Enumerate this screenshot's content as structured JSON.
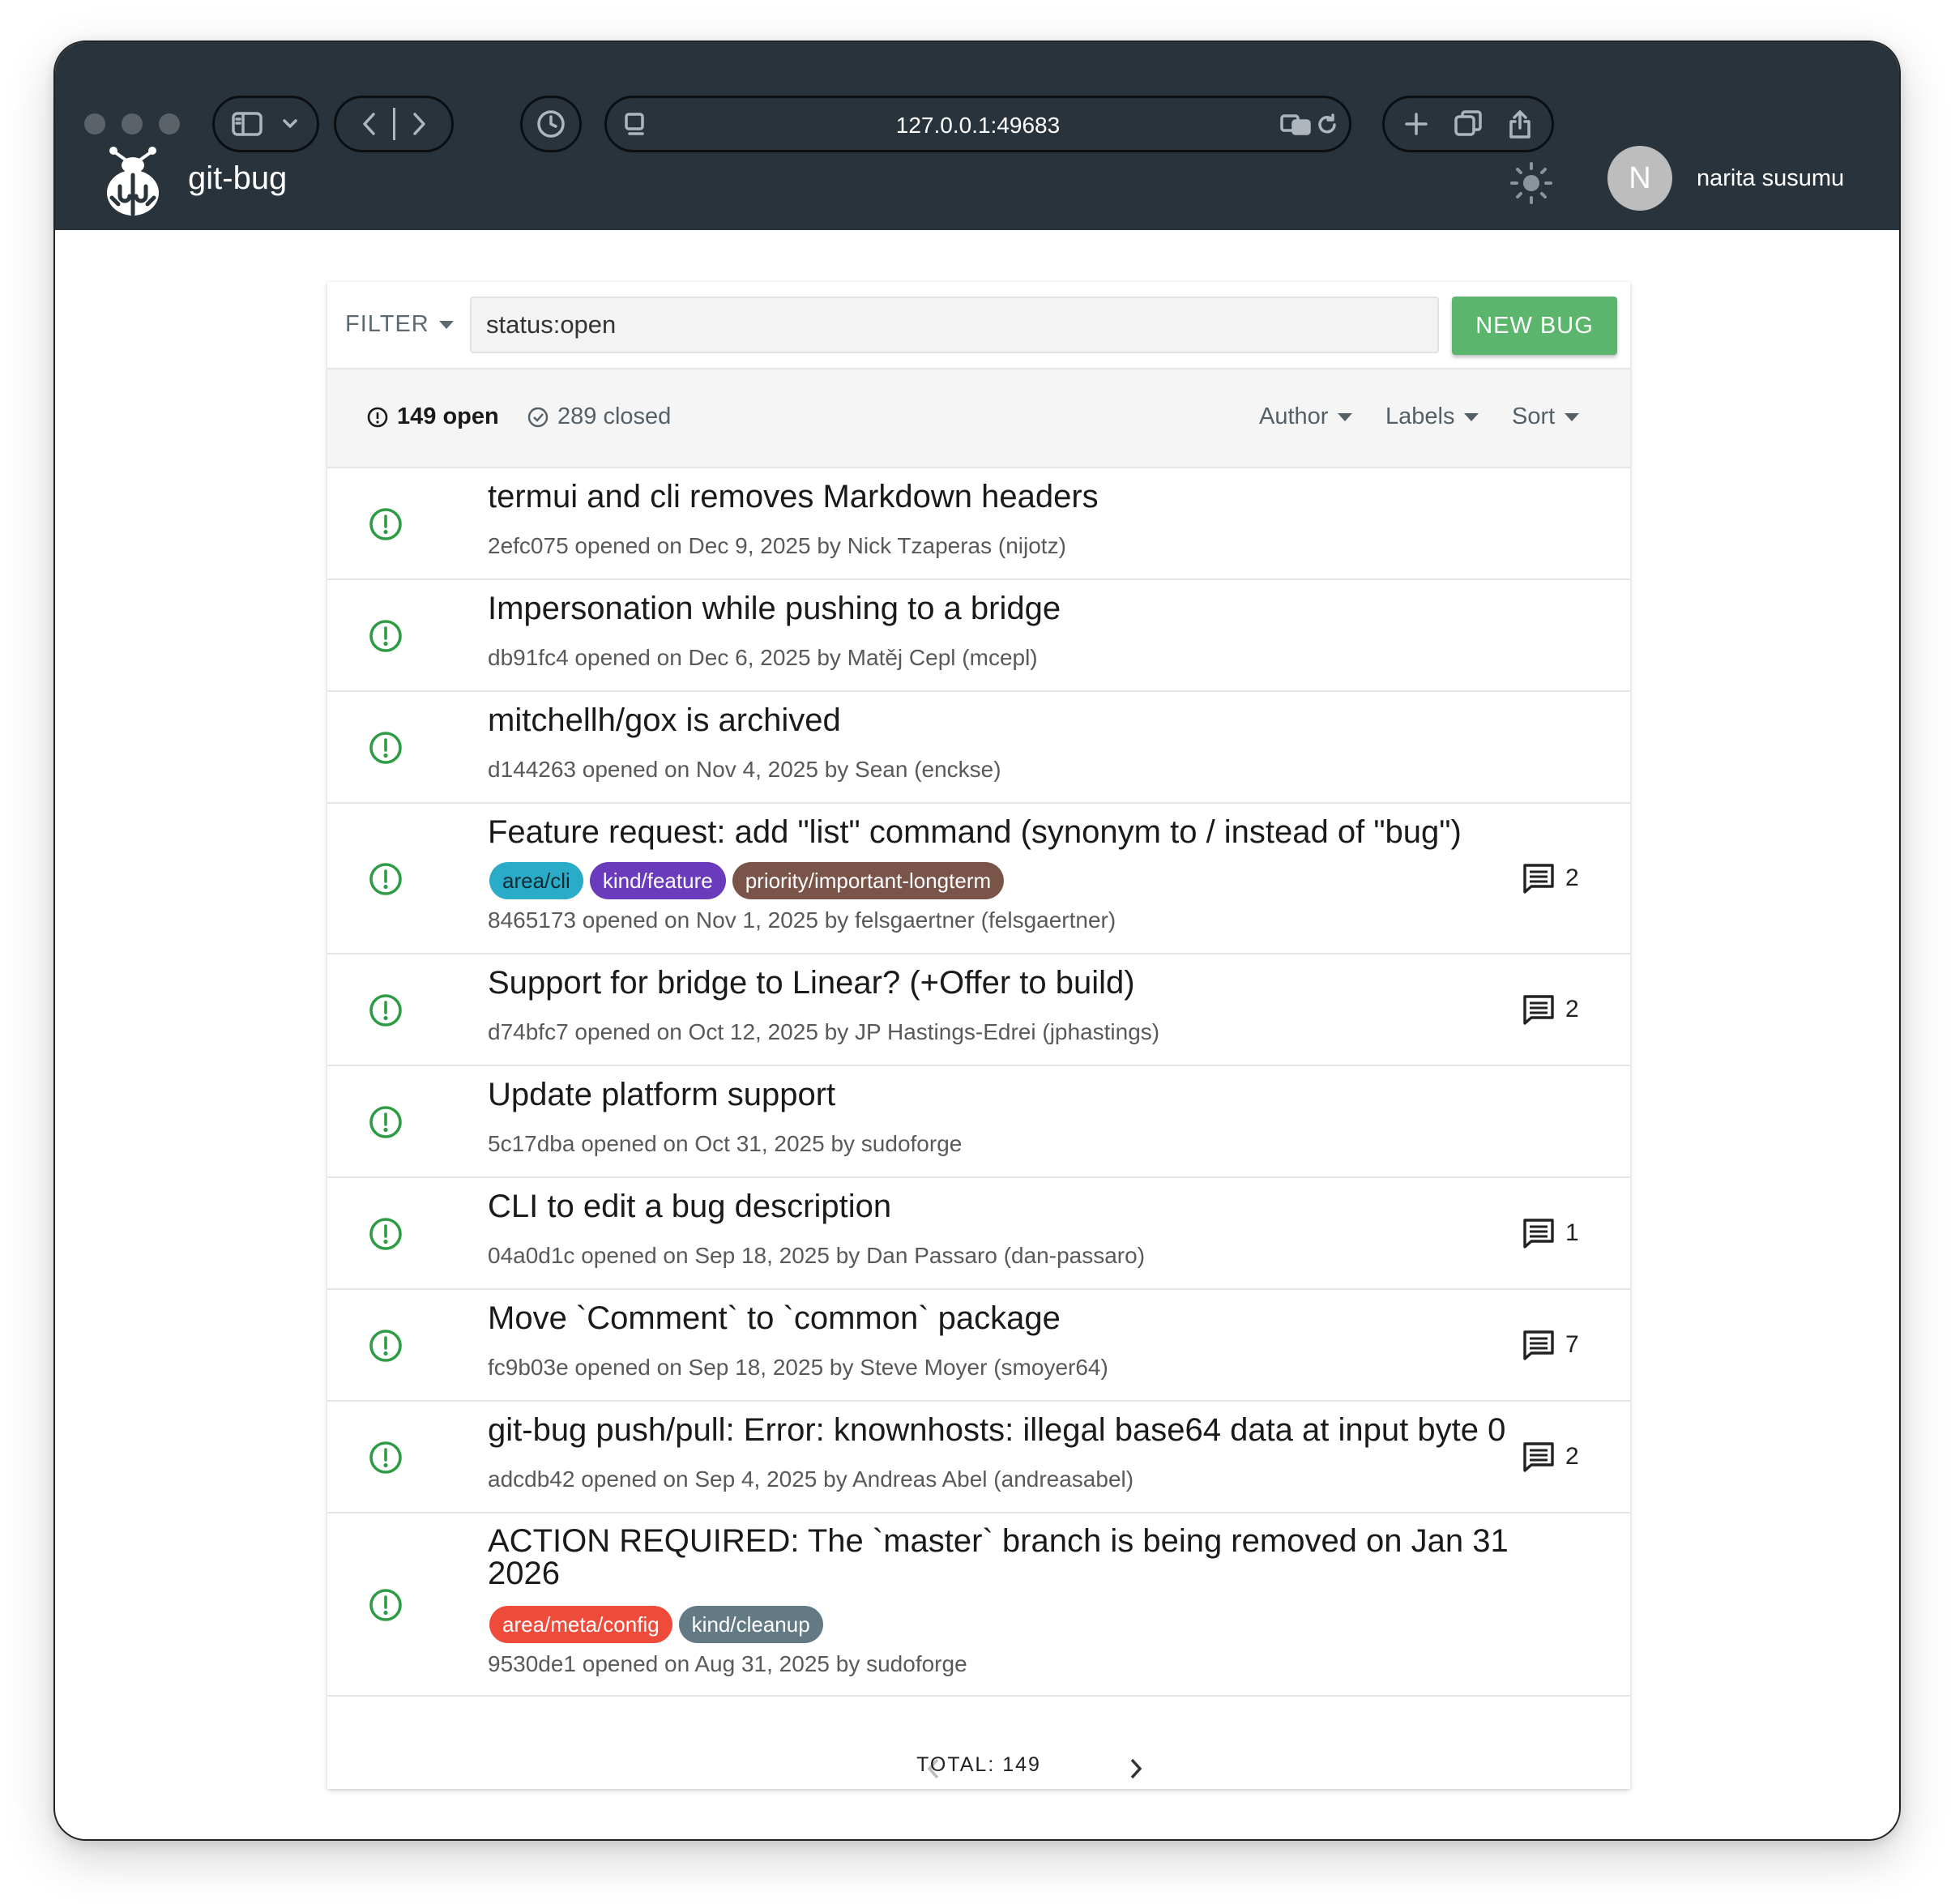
{
  "browser": {
    "url": "127.0.0.1:49683"
  },
  "app": {
    "name": "git-bug",
    "user_initial": "N",
    "user_name": "narita susumu"
  },
  "filter": {
    "label": "FILTER",
    "query": "status:open",
    "new_bug_label": "NEW BUG"
  },
  "tabs": {
    "open_count": "149 open",
    "closed_count": "289 closed",
    "author": "Author",
    "labels": "Labels",
    "sort": "Sort"
  },
  "bugs": [
    {
      "title": "termui and cli removes Markdown headers",
      "meta": "2efc075 opened on Dec 9, 2025 by Nick Tzaperas (nijotz)",
      "labels": [],
      "comments": ""
    },
    {
      "title": "Impersonation while pushing to a bridge",
      "meta": "db91fc4 opened on Dec 6, 2025 by Matěj Cepl (mcepl)",
      "labels": [],
      "comments": ""
    },
    {
      "title": "mitchellh/gox is archived",
      "meta": "d144263 opened on Nov 4, 2025 by Sean (enckse)",
      "labels": [],
      "comments": ""
    },
    {
      "title": "Feature request: add \"list\" command (synonym to / instead of \"bug\")",
      "meta": "8465173 opened on Nov 1, 2025 by felsgaertner (felsgaertner)",
      "labels": [
        {
          "text": "area/cli",
          "color": "#2aacc8",
          "fg": "#0d2a33"
        },
        {
          "text": "kind/feature",
          "color": "#6a3bbd",
          "fg": "#ffffff"
        },
        {
          "text": "priority/important-longterm",
          "color": "#7a5449",
          "fg": "#ffffff"
        }
      ],
      "comments": "2"
    },
    {
      "title": "Support for bridge to Linear? (+Offer to build)",
      "meta": "d74bfc7 opened on Oct 12, 2025 by JP Hastings-Edrei (jphastings)",
      "labels": [],
      "comments": "2"
    },
    {
      "title": "Update platform support",
      "meta": "5c17dba opened on Oct 31, 2025 by sudoforge",
      "labels": [],
      "comments": ""
    },
    {
      "title": "CLI to edit a bug description",
      "meta": "04a0d1c opened on Sep 18, 2025 by Dan Passaro (dan-passaro)",
      "labels": [],
      "comments": "1"
    },
    {
      "title": "Move `Comment` to `common` package",
      "meta": "fc9b03e opened on Sep 18, 2025 by Steve Moyer (smoyer64)",
      "labels": [],
      "comments": "7"
    },
    {
      "title": "git-bug push/pull: Error: knownhosts: illegal base64 data at input byte 0",
      "meta": "adcdb42 opened on Sep 4, 2025 by Andreas Abel (andreasabel)",
      "labels": [],
      "comments": "2"
    },
    {
      "title": "ACTION REQUIRED: The `master` branch is being removed on Jan 31 2026",
      "meta": "9530de1 opened on Aug 31, 2025 by sudoforge",
      "labels": [
        {
          "text": "area/meta/config",
          "color": "#ee4b3a",
          "fg": "#ffffff"
        },
        {
          "text": "kind/cleanup",
          "color": "#637a85",
          "fg": "#ffffff"
        }
      ],
      "comments": ""
    }
  ],
  "pager": {
    "total": "TOTAL: 149"
  },
  "colors": {
    "open_icon": "#2e9c44",
    "new_bug": "#5cb56c",
    "appbar": "#28333b"
  }
}
